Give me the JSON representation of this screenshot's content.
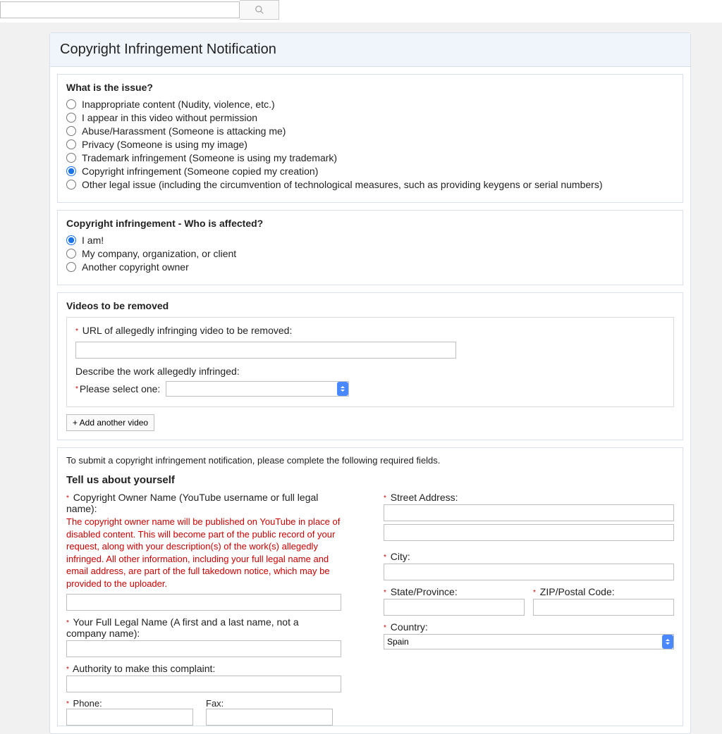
{
  "header": {
    "search_placeholder": ""
  },
  "panel_title": "Copyright Infringement Notification",
  "issue": {
    "title": "What is the issue?",
    "options": [
      "Inappropriate content (Nudity, violence, etc.)",
      "I appear in this video without permission",
      "Abuse/Harassment (Someone is attacking me)",
      "Privacy (Someone is using my image)",
      "Trademark infringement (Someone is using my trademark)",
      "Copyright infringement (Someone copied my creation)",
      "Other legal issue (including the circumvention of technological measures, such as providing keygens or serial numbers)"
    ],
    "selected_index": 5
  },
  "affected": {
    "title": "Copyright infringement - Who is affected?",
    "options": [
      "I am!",
      "My company, organization, or client",
      "Another copyright owner"
    ],
    "selected_index": 0
  },
  "videos": {
    "title": "Videos to be removed",
    "url_label": "URL of allegedly infringing video to be removed:",
    "describe_label": "Describe the work allegedly infringed:",
    "please_select_label": "Please select one:",
    "add_button": "+ Add another video"
  },
  "about": {
    "intro": "To submit a copyright infringement notification, please complete the following required fields.",
    "title": "Tell us about yourself",
    "owner_label": "Copyright Owner Name (YouTube username or full legal name):",
    "owner_warning": "The copyright owner name will be published on YouTube in place of disabled content. This will become part of the public record of your request, along with your description(s) of the work(s) allegedly infringed. All other information, including your full legal name and email address, are part of the full takedown notice, which may be provided to the uploader.",
    "legal_name_label": "Your Full Legal Name (A first and a last name, not a company name):",
    "authority_label": "Authority to make this complaint:",
    "phone_label": "Phone:",
    "fax_label": "Fax:",
    "street_label": "Street Address:",
    "city_label": "City:",
    "state_label": "State/Province:",
    "zip_label": "ZIP/Postal Code:",
    "country_label": "Country:",
    "country_value": "Spain"
  }
}
